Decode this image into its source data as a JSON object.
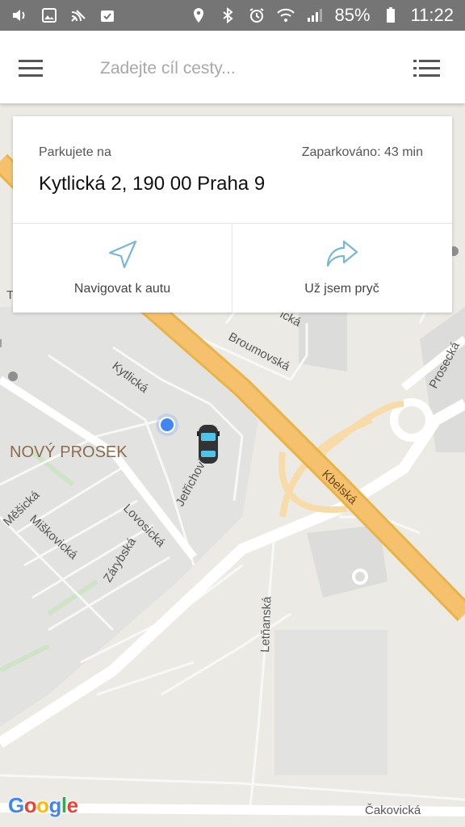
{
  "status_bar": {
    "battery": "85%",
    "time": "11:22",
    "left_icons": [
      "volume-icon",
      "image-icon",
      "cast-icon",
      "clipboard-icon"
    ],
    "right_icons": [
      "location-icon",
      "bluetooth-icon",
      "alarm-icon",
      "wifi-icon",
      "signal-icon",
      "battery-icon"
    ]
  },
  "top_bar": {
    "search_placeholder": "Zadejte cíl cesty..."
  },
  "parking_card": {
    "label": "Parkujete na",
    "time": "Zaparkováno: 43 min",
    "address": "Kytlická 2, 190 00 Praha 9",
    "actions": [
      {
        "label": "Navigovat k autu",
        "icon": "navigation-arrow-icon"
      },
      {
        "label": "Už jsem pryč",
        "icon": "share-arrow-icon"
      }
    ]
  },
  "map": {
    "area_label": "NOVÝ PROSEK",
    "streets": [
      "Kytlická",
      "Jetřichovická",
      "Lovosická",
      "Zárybská",
      "Měšická",
      "Miškovická",
      "Broumovská",
      "Kbelská",
      "Prosecká",
      "Letňanská",
      "Čakovická"
    ],
    "partial_labels": [
      "T",
      "ická"
    ],
    "attribution": "Google"
  },
  "colors": {
    "accent": "#7ab6d8",
    "location_dot": "#4285f4",
    "highway": "#f5c16c",
    "status_bar": "#757575"
  }
}
